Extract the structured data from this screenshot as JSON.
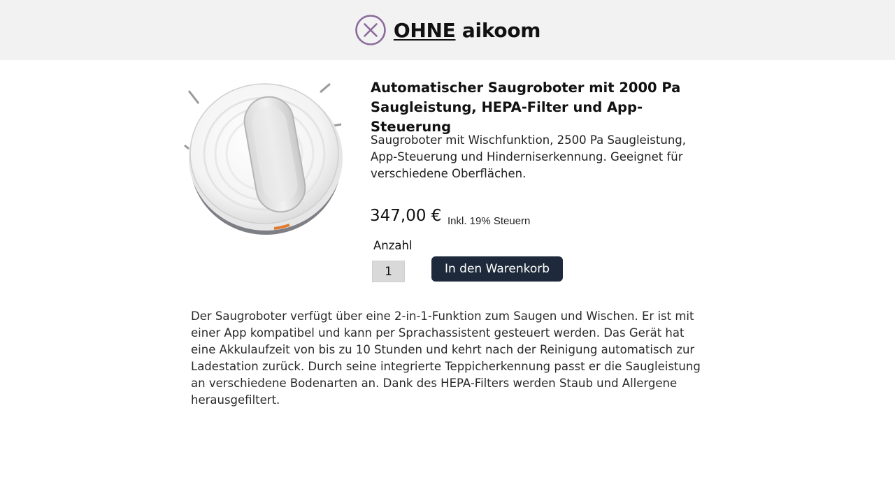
{
  "header": {
    "brand_ohne": "OHNE",
    "brand_name": "aikoom",
    "icon": "close-circle-icon",
    "icon_color": "#8c6a9c",
    "background": "#f2f2f2"
  },
  "product": {
    "image": "robot-vacuum-image",
    "title": "Automatischer Saugroboter mit 2000 Pa Saugleistung, HEPA-Filter und App-Steuerung",
    "short_description": "Saugroboter mit Wischfunktion, 2500 Pa Saugleistung, App-Steuerung und Hinderniserkennung. Geeignet für verschiedene Oberflächen.",
    "price": "347,00 €",
    "tax_note": "Inkl. 19% Steuern",
    "quantity_label": "Anzahl",
    "quantity_value": "1",
    "add_to_cart_label": "In den Warenkorb",
    "button_color": "#1e2a3b",
    "description": "Der Saugroboter verfügt über eine 2-in-1-Funktion zum Saugen und Wischen. Er ist mit einer App kompatibel und kann per Sprachassistent gesteuert werden. Das Gerät hat eine Akkulaufzeit von bis zu 10 Stunden und kehrt nach der Reinigung automatisch zur Ladestation zurück. Durch seine integrierte Teppicherkennung passt er die Saugleistung an verschiedene Bodenarten an. Dank des HEPA-Filters werden Staub und Allergene herausgefiltert."
  }
}
